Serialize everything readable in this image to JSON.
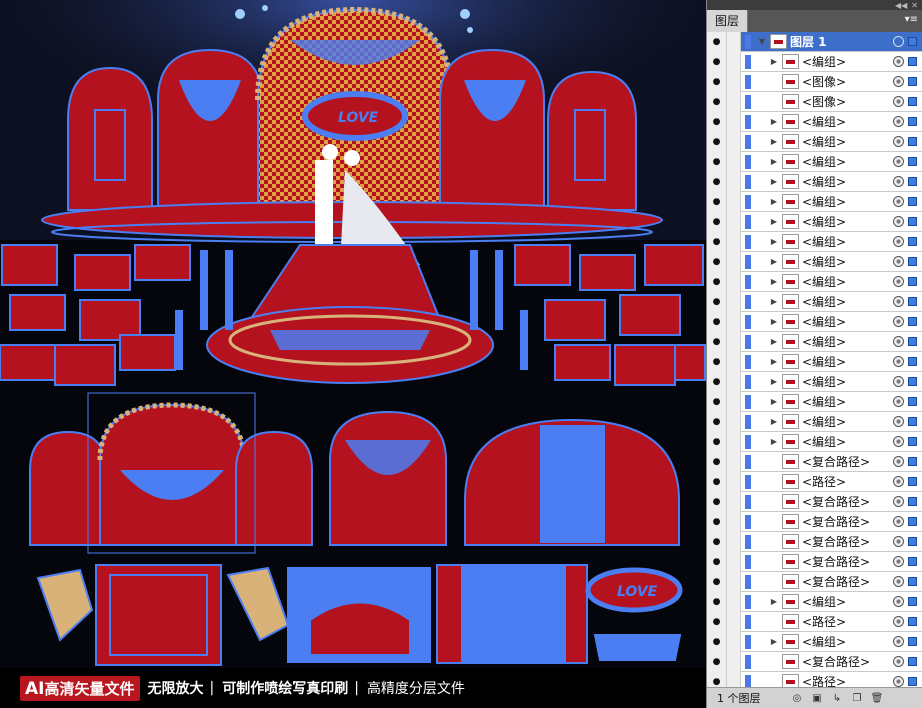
{
  "panel": {
    "tab_label": "图层",
    "layer_count": "1 个图层",
    "top_controls": [
      "◀◀",
      "✕"
    ],
    "menu_icon": "▾≡",
    "bottom_icons": [
      "make-clipping-mask-icon",
      "new-sublayer-icon",
      "new-layer-icon",
      "trash-icon"
    ]
  },
  "layers": [
    {
      "label": "图层 1",
      "type": "layer",
      "selected": true
    },
    {
      "label": "<编组>",
      "type": "group"
    },
    {
      "label": "<图像>",
      "type": "image"
    },
    {
      "label": "<图像>",
      "type": "image"
    },
    {
      "label": "<编组>",
      "type": "group"
    },
    {
      "label": "<编组>",
      "type": "group"
    },
    {
      "label": "<编组>",
      "type": "group"
    },
    {
      "label": "<编组>",
      "type": "group"
    },
    {
      "label": "<编组>",
      "type": "group"
    },
    {
      "label": "<编组>",
      "type": "group"
    },
    {
      "label": "<编组>",
      "type": "group"
    },
    {
      "label": "<编组>",
      "type": "group"
    },
    {
      "label": "<编组>",
      "type": "group"
    },
    {
      "label": "<编组>",
      "type": "group"
    },
    {
      "label": "<编组>",
      "type": "group"
    },
    {
      "label": "<编组>",
      "type": "group"
    },
    {
      "label": "<编组>",
      "type": "group"
    },
    {
      "label": "<编组>",
      "type": "group"
    },
    {
      "label": "<编组>",
      "type": "group"
    },
    {
      "label": "<编组>",
      "type": "group"
    },
    {
      "label": "<编组>",
      "type": "group"
    },
    {
      "label": "<复合路径>",
      "type": "compound"
    },
    {
      "label": "<路径>",
      "type": "path"
    },
    {
      "label": "<复合路径>",
      "type": "compound"
    },
    {
      "label": "<复合路径>",
      "type": "compound"
    },
    {
      "label": "<复合路径>",
      "type": "compound"
    },
    {
      "label": "<复合路径>",
      "type": "compound"
    },
    {
      "label": "<复合路径>",
      "type": "compound"
    },
    {
      "label": "<编组>",
      "type": "group"
    },
    {
      "label": "<路径>",
      "type": "path"
    },
    {
      "label": "<编组>",
      "type": "group"
    },
    {
      "label": "<复合路径>",
      "type": "compound"
    },
    {
      "label": "<路径>",
      "type": "path"
    }
  ],
  "canvas": {
    "love_sign_top": "LOVE",
    "love_sign_bottom": "LOVE",
    "colors": {
      "red": "#b3121e",
      "selection_blue": "#4b7ef2",
      "gold": "#d9b27a",
      "dark_bg": "#05060c"
    }
  },
  "banner": {
    "badge_ai": "AI",
    "badge_text": "高清矢量文件",
    "part1": "无限放大",
    "sep1": "|",
    "part2": "可制作喷绘写真印刷",
    "sep2": "|",
    "part3": "高精度分层文件"
  }
}
